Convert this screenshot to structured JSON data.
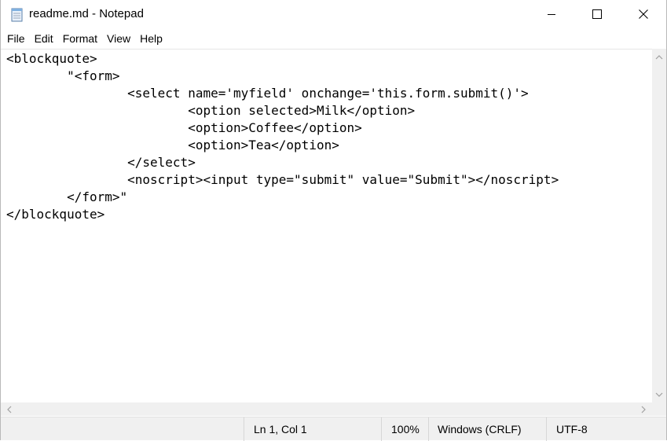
{
  "window": {
    "title": "readme.md - Notepad",
    "icon": "notepad-icon"
  },
  "titlebar_buttons": {
    "minimize": "minimize-icon",
    "maximize": "maximize-icon",
    "close": "close-icon"
  },
  "menu": {
    "items": [
      "File",
      "Edit",
      "Format",
      "View",
      "Help"
    ]
  },
  "editor": {
    "lines": [
      "<blockquote>",
      "\t\"<form>",
      "\t\t<select name='myfield' onchange='this.form.submit()'>",
      "\t\t\t<option selected>Milk</option>",
      "\t\t\t<option>Coffee</option>",
      "\t\t\t<option>Tea</option>",
      "\t\t</select>",
      "\t\t<noscript><input type=\"submit\" value=\"Submit\"></noscript>",
      "\t</form>\"",
      "</blockquote>"
    ]
  },
  "status": {
    "position": "Ln 1, Col 1",
    "zoom": "100%",
    "line_ending": "Windows (CRLF)",
    "encoding": "UTF-8"
  },
  "colors": {
    "chrome_bg": "#f0f0f0",
    "text": "#000000"
  }
}
